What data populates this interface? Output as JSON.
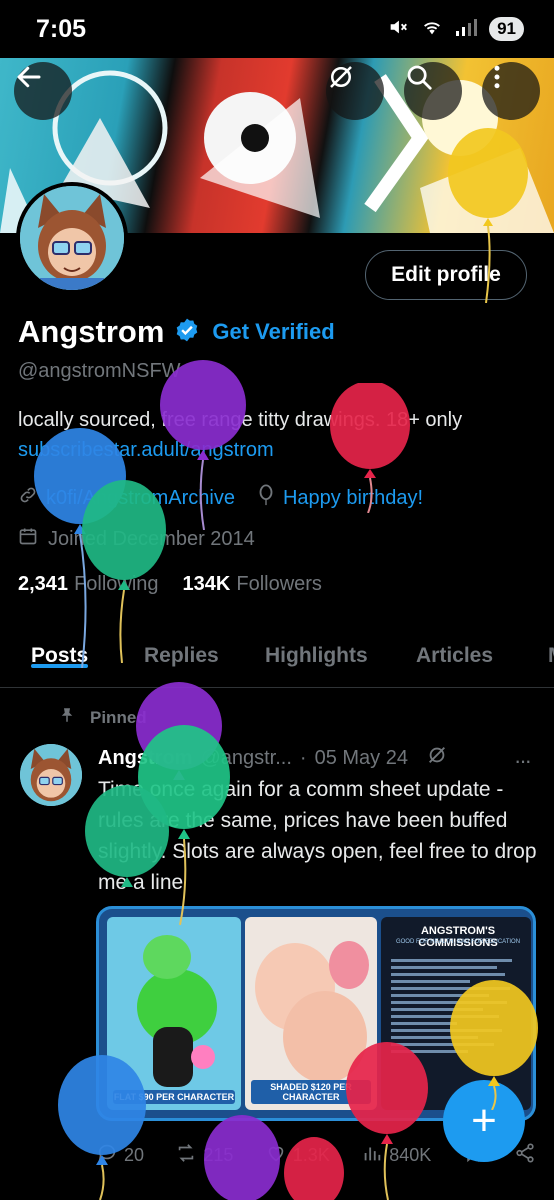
{
  "status_bar": {
    "time": "7:05",
    "battery": "91"
  },
  "header": {
    "edit_profile_label": "Edit profile"
  },
  "profile": {
    "display_name": "Angstrom",
    "get_verified_label": "Get Verified",
    "handle": "@angstromNSFW",
    "bio_text": "locally sourced, free range titty drawings. 18+ only ",
    "bio_link": "subscribestar.adult/angstrom",
    "link_text": "k0fi/AngstromArchive",
    "birthday_text": "Happy birthday!",
    "joined_text": "Joined December 2014",
    "following_count": "2,341",
    "following_label": "Following",
    "followers_count": "134K",
    "followers_label": "Followers"
  },
  "tabs": [
    {
      "label": "Posts"
    },
    {
      "label": "Replies"
    },
    {
      "label": "Highlights"
    },
    {
      "label": "Articles"
    },
    {
      "label": "M"
    }
  ],
  "post": {
    "pinned_label": "Pinned",
    "author": "Angstrom",
    "handle": "@angstr...",
    "separator": "·",
    "date": "05 May 24",
    "more": "···",
    "text": "Time once again for a comm sheet update - rules are the same, prices have been buffed slightly. Slots are always open, feel free to drop me a line",
    "media": {
      "caption_left": "FLAT $90 PER CHARACTER",
      "caption_middle": "SHADED $120 PER CHARACTER",
      "sheet_title": "ANGSTROM'S COMMISSIONS",
      "sheet_subtitle": "GOOD FOR HEALTH, BAD FOR EDUCATION"
    },
    "stats": {
      "replies": "20",
      "reposts": "215",
      "likes": "1.3K",
      "views": "840K"
    }
  },
  "fab_label": "+",
  "colors": {
    "accent": "#1d9bf0",
    "background": "#000000",
    "muted": "#71767b"
  },
  "icons": [
    "back-arrow-icon",
    "hide-icon",
    "search-icon",
    "more-icon",
    "verified-icon",
    "link-icon",
    "balloon-icon",
    "calendar-icon",
    "pin-icon",
    "reply-icon",
    "repost-icon",
    "like-icon",
    "views-icon",
    "bookmark-icon",
    "share-icon",
    "compose-icon"
  ]
}
